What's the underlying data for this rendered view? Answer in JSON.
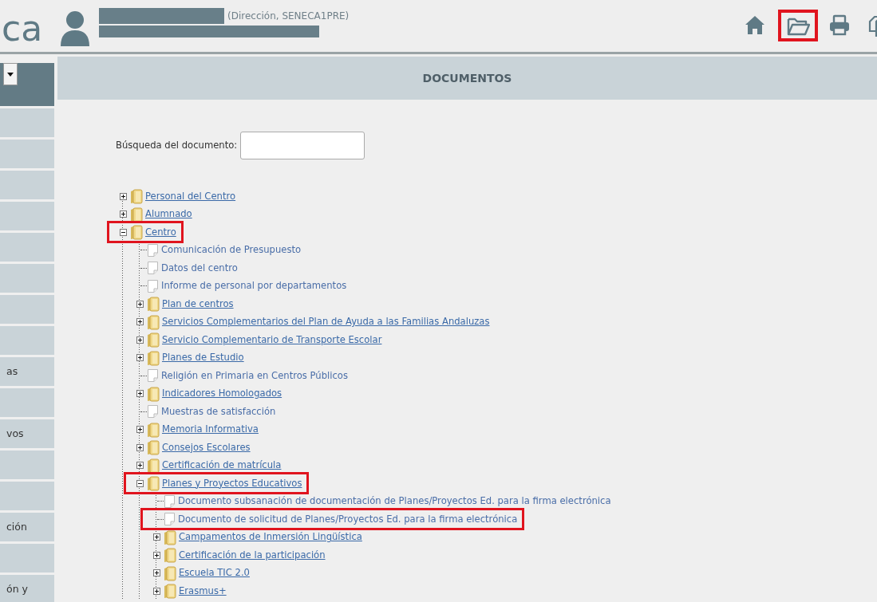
{
  "header": {
    "logo_text": "ca",
    "user_role": "(Dirección, SENECA1PRE)",
    "toolbar": [
      {
        "kind": "home",
        "highlighted": false
      },
      {
        "kind": "folder",
        "highlighted": true
      },
      {
        "kind": "print",
        "highlighted": false
      },
      {
        "kind": "copy",
        "highlighted": false
      }
    ]
  },
  "sidebar": {
    "items": [
      {
        "kind": "blank"
      },
      {
        "kind": "blank"
      },
      {
        "kind": "blank"
      },
      {
        "kind": "blank"
      },
      {
        "kind": "blank"
      },
      {
        "kind": "blank"
      },
      {
        "kind": "blank"
      },
      {
        "kind": "blank"
      },
      {
        "kind": "text",
        "label": "as"
      },
      {
        "kind": "blank"
      },
      {
        "kind": "text",
        "label": "vos"
      },
      {
        "kind": "blank"
      },
      {
        "kind": "blank"
      },
      {
        "kind": "text",
        "label": "ción"
      },
      {
        "kind": "blank"
      },
      {
        "kind": "text",
        "label": "ón y"
      }
    ]
  },
  "main": {
    "title": "DOCUMENTOS",
    "search": {
      "label": "Búsqueda del documento:"
    },
    "tree": [
      {
        "kind": "folder",
        "label": "Personal del Centro",
        "expanded": false,
        "highlighted": false
      },
      {
        "kind": "folder",
        "label": "Alumnado",
        "expanded": false,
        "highlighted": false
      },
      {
        "kind": "folder",
        "label": "Centro",
        "expanded": true,
        "highlighted": true,
        "children": [
          {
            "kind": "document",
            "label": "Comunicación de Presupuesto",
            "highlighted": false
          },
          {
            "kind": "document",
            "label": "Datos del centro",
            "highlighted": false
          },
          {
            "kind": "document",
            "label": "Informe de personal por departamentos",
            "highlighted": false
          },
          {
            "kind": "folder",
            "label": "Plan de centros",
            "expanded": false,
            "highlighted": false
          },
          {
            "kind": "folder",
            "label": "Servicios Complementarios del Plan de Ayuda a las Familias Andaluzas",
            "expanded": false,
            "highlighted": false
          },
          {
            "kind": "folder",
            "label": "Servicio Complementario de Transporte Escolar",
            "expanded": false,
            "highlighted": false
          },
          {
            "kind": "folder",
            "label": "Planes de Estudio",
            "expanded": false,
            "highlighted": false
          },
          {
            "kind": "document",
            "label": "Religión en Primaria en Centros Públicos",
            "highlighted": false
          },
          {
            "kind": "folder",
            "label": "Indicadores Homologados",
            "expanded": false,
            "highlighted": false
          },
          {
            "kind": "document",
            "label": "Muestras de satisfacción",
            "highlighted": false
          },
          {
            "kind": "folder",
            "label": "Memoria Informativa",
            "expanded": false,
            "highlighted": false
          },
          {
            "kind": "folder",
            "label": "Consejos Escolares",
            "expanded": false,
            "highlighted": false
          },
          {
            "kind": "folder",
            "label": "Certificación de matrícula",
            "expanded": false,
            "highlighted": false
          },
          {
            "kind": "folder",
            "label": "Planes y Proyectos Educativos",
            "expanded": true,
            "highlighted": true,
            "children": [
              {
                "kind": "document",
                "label": "Documento subsanación de documentación de Planes/Proyectos Ed. para la firma electrónica",
                "highlighted": false
              },
              {
                "kind": "document",
                "label": "Documento de solicitud de Planes/Proyectos Ed. para la firma electrónica",
                "highlighted": true
              },
              {
                "kind": "folder",
                "label": "Campamentos de Inmersión Lingüística",
                "expanded": false,
                "highlighted": false
              },
              {
                "kind": "folder",
                "label": "Certificación de la participación",
                "expanded": false,
                "highlighted": false
              },
              {
                "kind": "folder",
                "label": "Escuela TIC 2.0",
                "expanded": false,
                "highlighted": false
              },
              {
                "kind": "folder",
                "label": "Erasmus+",
                "expanded": false,
                "highlighted": false
              }
            ]
          }
        ]
      }
    ]
  }
}
